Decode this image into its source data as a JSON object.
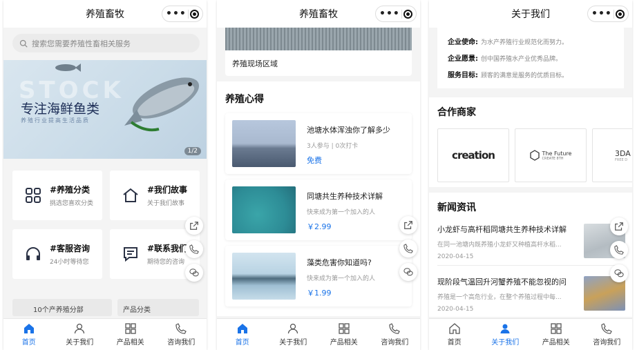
{
  "screen1": {
    "nav_title": "养殖畜牧",
    "search_placeholder": "搜索您需要养殖性畜相关服务",
    "banner": {
      "bg_text": "STOCK",
      "title": "专注海鲜鱼类",
      "subtitle": "养殖行业提高生活品质",
      "indicator": "1/2"
    },
    "grid": [
      {
        "title": "#养殖分类",
        "desc": "挑选您喜欢分类",
        "icon": "grid-icon"
      },
      {
        "title": "#我们故事",
        "desc": "关于我们故事",
        "icon": "home-icon"
      },
      {
        "title": "#客服咨询",
        "desc": "24小时等待您",
        "icon": "headset-icon"
      },
      {
        "title": "#联系我们",
        "desc": "期待您的咨询",
        "icon": "message-icon"
      }
    ],
    "peek": [
      "10个产养殖分部",
      "产品分类"
    ]
  },
  "screen2": {
    "nav_title": "养殖畜牧",
    "top_caption": "养殖现场区域",
    "section_title": "养殖心得",
    "items": [
      {
        "title": "池塘水体浑浊你了解多少",
        "meta": "3人参与 | 0次打卡",
        "price": "免费"
      },
      {
        "title": "同塘共生养种技术详解",
        "meta": "快来成为第一个加入的人",
        "price": "￥2.99"
      },
      {
        "title": "藻类危害你知道吗?",
        "meta": "快来成为第一个加入的人",
        "price": "￥1.99"
      }
    ]
  },
  "screen3": {
    "nav_title": "关于我们",
    "about": [
      {
        "label": "企业使命:",
        "value": "为水产养殖行业规范化而努力。"
      },
      {
        "label": "企业愿景:",
        "value": "创中国养殖水产业优秀品牌。"
      },
      {
        "label": "服务目标:",
        "value": "顾客的满意是服务的优质目标。"
      }
    ],
    "partners_title": "合作商家",
    "partners": [
      "creation",
      "The Future",
      "CREATE 8TH",
      "3DA",
      "FREE D"
    ],
    "news_title": "新闻资讯",
    "news": [
      {
        "title": "小龙虾与高杆稻同塘共生养种技术详解",
        "desc": "在同一池塘内既养殖小龙虾又种植高杆水稻...",
        "date": "2020-04-15"
      },
      {
        "title": "现阶段气温回升河蟹养殖不能忽视的问",
        "desc": "养殖是一个高危行业，在整个养殖过程中每...",
        "date": "2020-04-15"
      }
    ]
  },
  "tabbar": [
    "首页",
    "关于我们",
    "产品相关",
    "咨询我们"
  ],
  "colors": {
    "accent": "#1a73e8",
    "background": "#f4f4f4",
    "card": "#ffffff"
  }
}
